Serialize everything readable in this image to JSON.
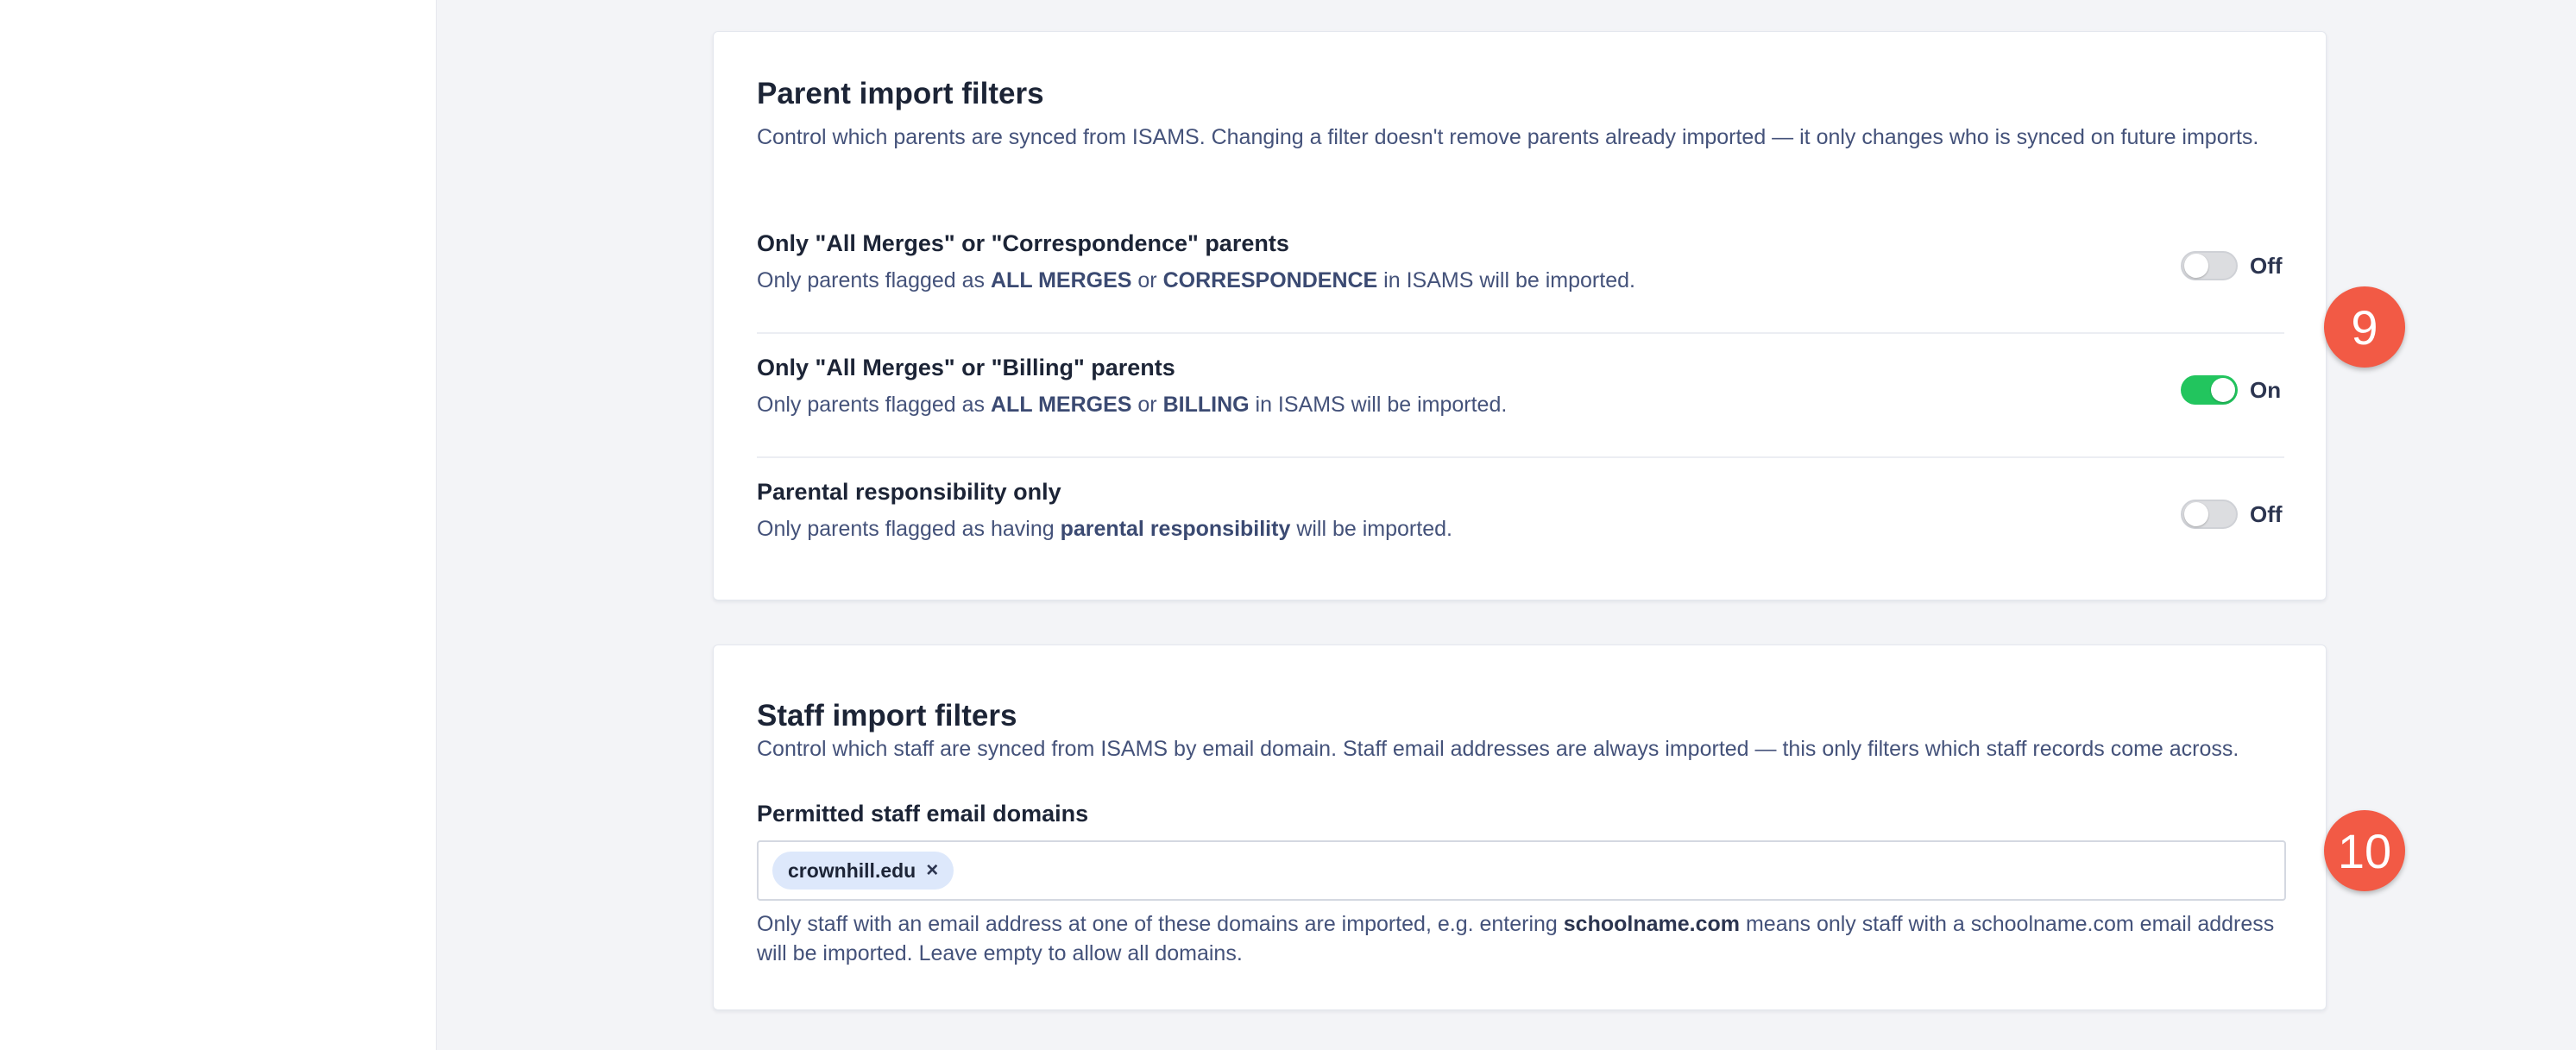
{
  "parent_filters": {
    "title": "Parent import filters",
    "description": "Control which parents are synced from ISAMS. Changing a filter doesn't remove parents already imported — it only changes who is synced on future imports.",
    "items": [
      {
        "title": "Only \"All Merges\" or \"Correspondence\" parents",
        "sub_prefix": "Only parents flagged as ",
        "sub_bold1": "ALL MERGES",
        "sub_mid": " or ",
        "sub_bold2": "CORRESPONDENCE",
        "sub_suffix": " in ISAMS will be imported.",
        "state": "off",
        "state_label": "Off"
      },
      {
        "title": "Only \"All Merges\" or \"Billing\" parents",
        "sub_prefix": "Only parents flagged as ",
        "sub_bold1": "ALL MERGES",
        "sub_mid": " or ",
        "sub_bold2": "BILLING",
        "sub_suffix": " in ISAMS will be imported.",
        "state": "on",
        "state_label": "On"
      },
      {
        "title": "Parental responsibility only",
        "sub_prefix": "Only parents flagged as having ",
        "sub_bold1": "parental responsibility",
        "sub_suffix": " will be imported.",
        "state": "off",
        "state_label": "Off"
      }
    ]
  },
  "staff_filters": {
    "title": "Staff import filters",
    "description": "Control which staff are synced from ISAMS by email domain. Staff email addresses are always imported — this only filters which staff records come across.",
    "field_label": "Permitted staff email domains",
    "tags": [
      "crownhill.edu"
    ],
    "tag_remove_glyph": "×",
    "hint_prefix": "Only staff with an email address at one of these domains are imported, e.g. entering ",
    "hint_bold": "schoolname.com",
    "hint_suffix": " means only staff with a schoolname.com email address will be imported. Leave empty to allow all domains."
  },
  "annotations": [
    "9",
    "10"
  ],
  "colors": {
    "toggle_on": "#22c55e",
    "toggle_off": "#dcdde0",
    "badge": "#f25a45",
    "tag_bg": "#dde8fb"
  }
}
